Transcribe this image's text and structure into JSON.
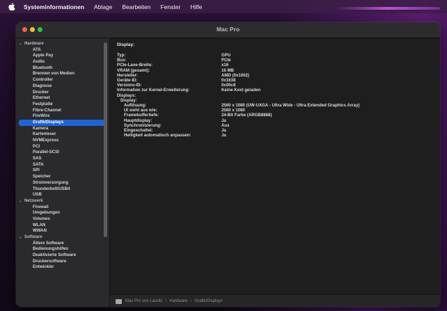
{
  "menubar": {
    "app": "Systeminformationen",
    "items": [
      "Ablage",
      "Bearbeiten",
      "Fenster",
      "Hilfe"
    ]
  },
  "window": {
    "title": "Mac Pro"
  },
  "sidebar": {
    "groups": [
      {
        "label": "Hardware",
        "items": [
          "ATA",
          "Apple Pay",
          "Audio",
          "Bluetooth",
          "Brennen von Medien",
          "Controller",
          "Diagnose",
          "Drucker",
          "Ethernet",
          "Festplatte",
          "Fibre-Channel",
          "FireWire",
          "Grafik/Displays",
          "Kamera",
          "Kartenleser",
          "NVMExpress",
          "PCI",
          "Parallel-SCSI",
          "SAS",
          "SATA",
          "SPI",
          "Speicher",
          "Stromversorgung",
          "Thunderbolt/USB4",
          "USB"
        ]
      },
      {
        "label": "Netzwerk",
        "items": [
          "Firewall",
          "Umgebungen",
          "Volumes",
          "WLAN",
          "WWAN"
        ]
      },
      {
        "label": "Software",
        "items": [
          "Ältere Software",
          "Bedienungshilfen",
          "Deaktivierte Software",
          "Druckersoftware",
          "Entwickler"
        ]
      }
    ],
    "selected": "Grafik/Displays"
  },
  "content": {
    "heading": "Display:",
    "rows": [
      {
        "key": "Typ:",
        "value": "GPU",
        "level": 0
      },
      {
        "key": "Bus:",
        "value": "PCIe",
        "level": 0
      },
      {
        "key": "PCIe-Lane-Breite:",
        "value": "x16",
        "level": 0
      },
      {
        "key": "VRAM (gesamt):",
        "value": "16 MB",
        "level": 0
      },
      {
        "key": "Hersteller:",
        "value": "AMD (0x1002)",
        "level": 0
      },
      {
        "key": "Geräte-ID:",
        "value": "0x1638",
        "level": 0
      },
      {
        "key": "Versions-ID:",
        "value": "0x00c8",
        "level": 0
      },
      {
        "key": "Information zur Kernel-Erweiterung:",
        "value": "Keine Kext geladen",
        "level": 0
      },
      {
        "key": "Displays:",
        "value": "",
        "level": 0
      },
      {
        "key": "Display:",
        "value": "",
        "level": 1
      },
      {
        "key": "Auflösung:",
        "value": "2560 x 1080 (UW-UXGA - Ultra Wide - Ultra Extended Graphics Array)",
        "level": 2
      },
      {
        "key": "UI sieht aus wie:",
        "value": "2560 x 1080",
        "level": 2
      },
      {
        "key": "Framebuffertiefe:",
        "value": "24-Bit Farbe (ARGB8888)",
        "level": 2
      },
      {
        "key": "Hauptdisplay:",
        "value": "Ja",
        "level": 2
      },
      {
        "key": "Synchronisierung:",
        "value": "Aus",
        "level": 2
      },
      {
        "key": "Eingeschaltet:",
        "value": "Ja",
        "level": 2
      },
      {
        "key": "Helligkeit automatisch anpassen:",
        "value": "Ja",
        "level": 2
      }
    ]
  },
  "pathbar": {
    "parts": [
      "Mac Pro von Lauritz",
      "Hardware",
      "Grafik/Displays"
    ],
    "separator": "›"
  }
}
